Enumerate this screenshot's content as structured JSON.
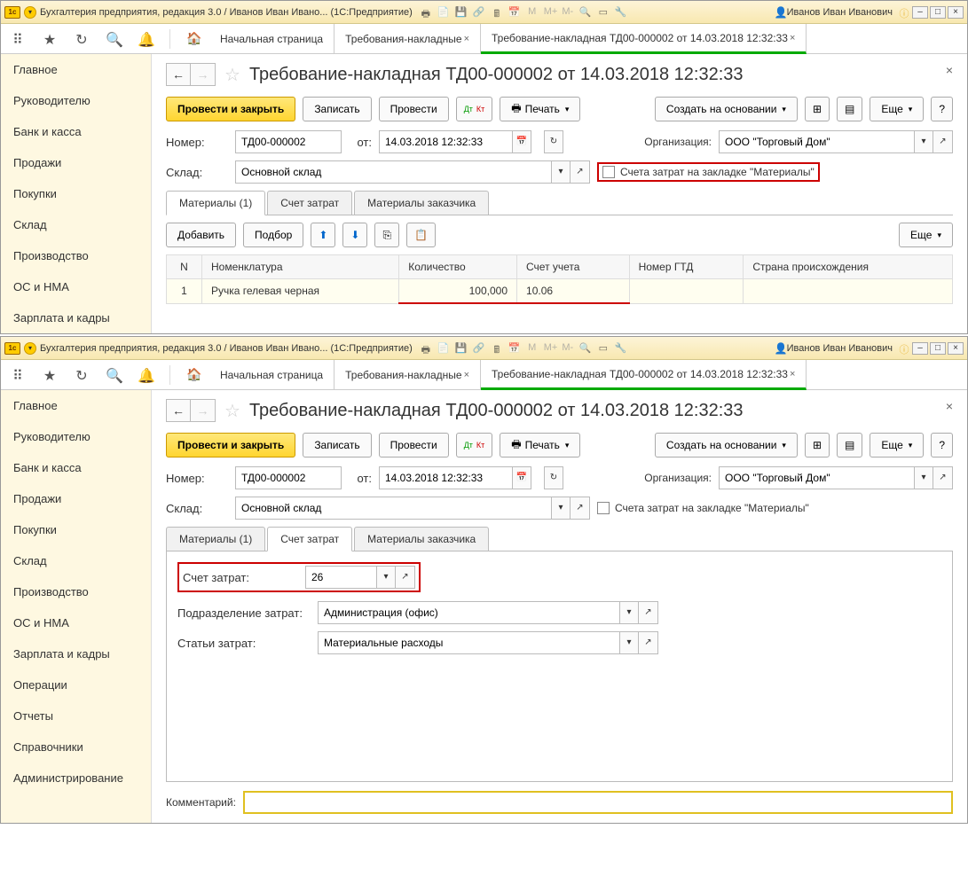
{
  "app_title": "Бухгалтерия предприятия, редакция 3.0 / Иванов Иван Ивано...  (1С:Предприятие)",
  "user_name": "Иванов Иван Иванович",
  "home_tab": "Начальная страница",
  "tab_list": "Требования-накладные",
  "tab_doc": "Требование-накладная ТД00-000002 от 14.03.2018 12:32:33",
  "page_title": "Требование-накладная ТД00-000002 от 14.03.2018 12:32:33",
  "sidebar": {
    "items": [
      "Главное",
      "Руководителю",
      "Банк и касса",
      "Продажи",
      "Покупки",
      "Склад",
      "Производство",
      "ОС и НМА",
      "Зарплата и кадры",
      "Операции",
      "Отчеты",
      "Справочники",
      "Администрирование"
    ]
  },
  "actions": {
    "post_close": "Провести и закрыть",
    "save": "Записать",
    "post": "Провести",
    "print": "Печать",
    "create_based": "Создать на основании",
    "more": "Еще"
  },
  "form": {
    "number_lbl": "Номер:",
    "number_val": "ТД00-000002",
    "from_lbl": "от:",
    "date_val": "14.03.2018 12:32:33",
    "org_lbl": "Организация:",
    "org_val": "ООО \"Торговый Дом\"",
    "warehouse_lbl": "Склад:",
    "warehouse_val": "Основной склад",
    "cost_checkbox": "Счета затрат на закладке \"Материалы\""
  },
  "inner_tabs": {
    "materials": "Материалы (1)",
    "cost": "Счет затрат",
    "customer_mat": "Материалы заказчика"
  },
  "tbl_actions": {
    "add": "Добавить",
    "pick": "Подбор"
  },
  "table": {
    "headers": [
      "N",
      "Номенклатура",
      "Количество",
      "Счет учета",
      "Номер ГТД",
      "Страна происхождения"
    ],
    "row": {
      "n": "1",
      "item": "Ручка гелевая черная",
      "qty": "100,000",
      "acct": "10.06",
      "gtd": "",
      "country": ""
    }
  },
  "cost_pane": {
    "acct_lbl": "Счет затрат:",
    "acct_val": "26",
    "dept_lbl": "Подразделение затрат:",
    "dept_val": "Администрация (офис)",
    "item_lbl": "Статьи затрат:",
    "item_val": "Материальные расходы"
  },
  "comment_lbl": "Комментарий:"
}
